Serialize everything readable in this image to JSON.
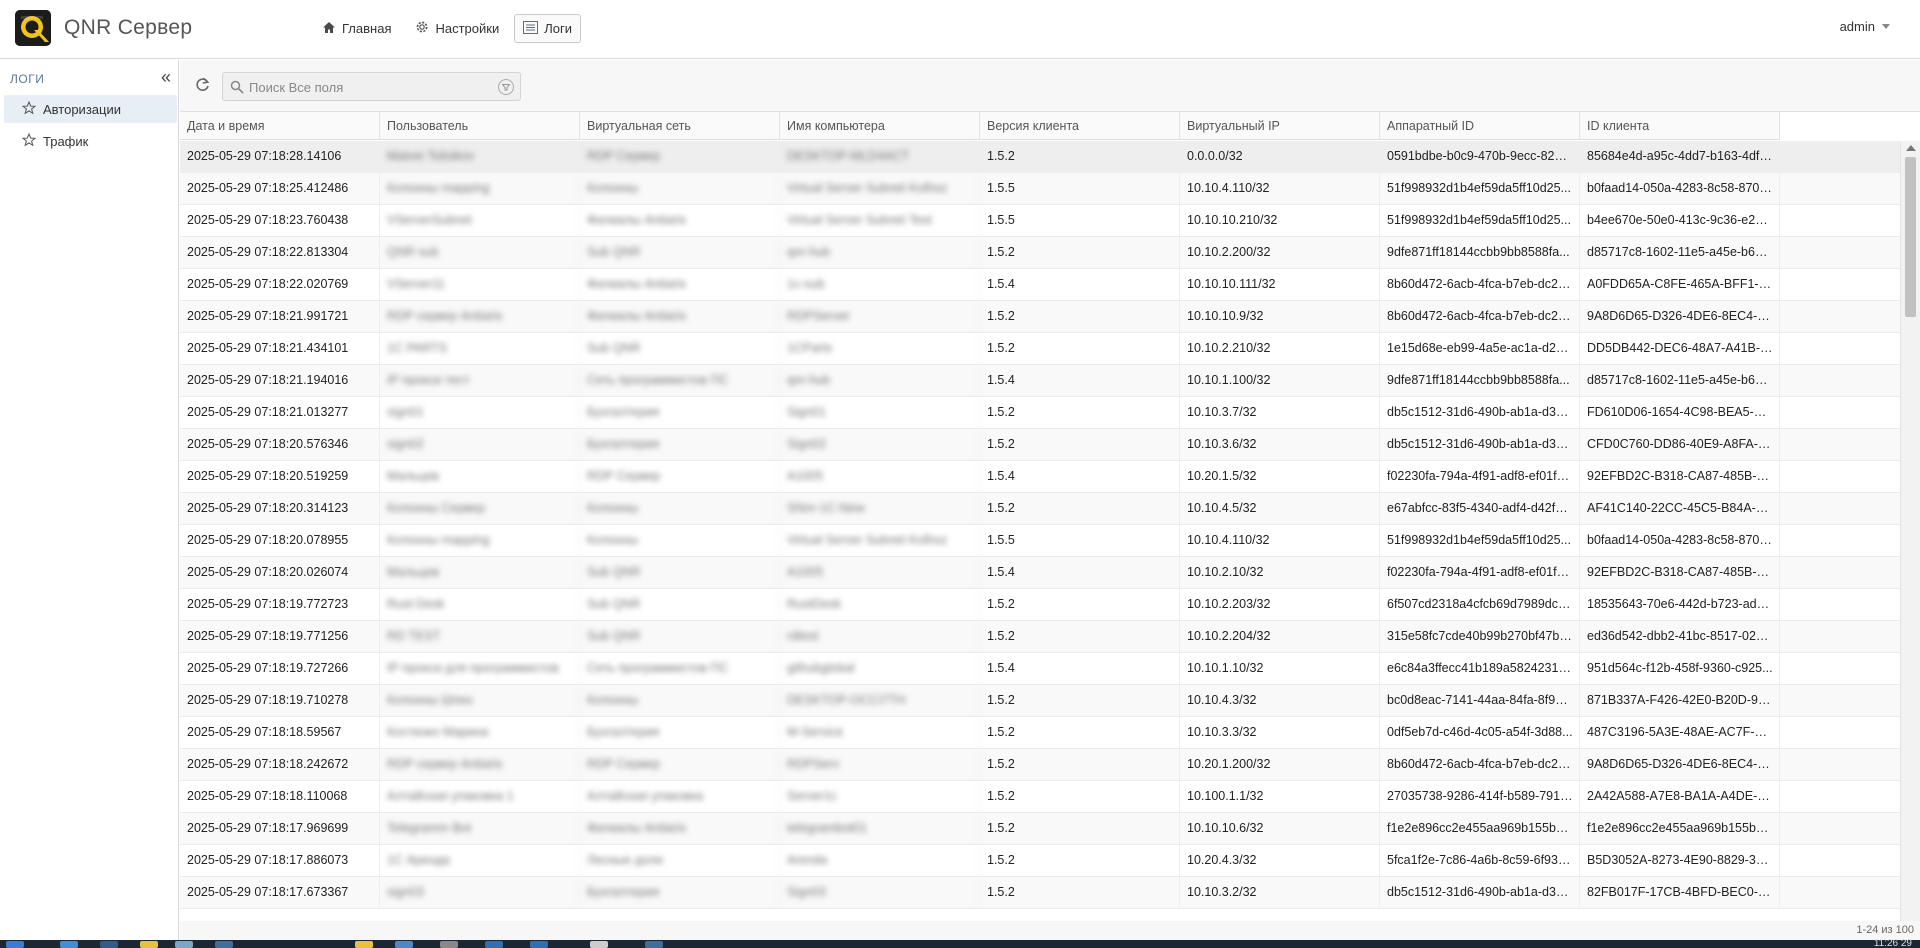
{
  "header": {
    "app_title": "QNR Сервер",
    "nav": [
      {
        "label": "Главная",
        "icon": "home-icon"
      },
      {
        "label": "Настройки",
        "icon": "gear-icon"
      },
      {
        "label": "Логи",
        "icon": "list-icon"
      }
    ],
    "active_nav": "Логи",
    "user": "admin"
  },
  "sidebar": {
    "title": "Логи",
    "items": [
      {
        "label": "Авторизации",
        "icon": "star-icon"
      },
      {
        "label": "Трафик",
        "icon": "star-icon"
      }
    ],
    "active_item": "Авторизации"
  },
  "toolbar": {
    "search_placeholder": "Поиск Все поля"
  },
  "table": {
    "columns": [
      "Дата и время",
      "Пользователь",
      "Виртуальная сеть",
      "Имя компьютера",
      "Версия клиента",
      "Виртуальный IP",
      "Аппаратный ID",
      "ID клиента"
    ],
    "rows": [
      [
        "2025-05-29 07:18:28.14106",
        "Matvei Tsitsikov",
        "RDP Сервер",
        "DESKTOP-MLD4ACT",
        "1.5.2",
        "0.0.0.0/32",
        "0591bdbe-b0c9-470b-9ecc-822b...",
        "85684e4d-a95c-4dd7-b163-4df0..."
      ],
      [
        "2025-05-29 07:18:25.412486",
        "Колонны mapping",
        "Колонны",
        "Virtual Server Subnet Kolhoz",
        "1.5.5",
        "10.10.4.110/32",
        "51f998932d1b4ef59da5ff10d25...",
        "b0faad14-050a-4283-8c58-870c..."
      ],
      [
        "2025-05-29 07:18:23.760438",
        "VServerSubnet",
        "Филиалы Antiaris",
        "Virtual Server Subnet Test",
        "1.5.5",
        "10.10.10.210/32",
        "51f998932d1b4ef59da5ff10d25...",
        "b4ee670e-50e0-413c-9c36-e26f..."
      ],
      [
        "2025-05-29 07:18:22.813304",
        "QNR sub",
        "Sub QNR",
        "qnr-hub",
        "1.5.2",
        "10.10.2.200/32",
        "9dfe871ff18144ccbb9bb8588fa...",
        "d85717c8-1602-11e5-a45e-b6a7..."
      ],
      [
        "2025-05-29 07:18:22.020769",
        "VServer11",
        "Филиалы Antiaris",
        "1c-sub",
        "1.5.4",
        "10.10.10.111/32",
        "8b60d472-6acb-4fca-b7eb-dc23...",
        "A0FDD65A-C8FE-465A-BFF1-F73..."
      ],
      [
        "2025-05-29 07:18:21.991721",
        "RDP сервер Antiaris",
        "Филиалы Antiaris",
        "RDPServer",
        "1.5.2",
        "10.10.10.9/32",
        "8b60d472-6acb-4fca-b7eb-dc23...",
        "9A8D6D65-D326-4DE6-8EC4-6D..."
      ],
      [
        "2025-05-29 07:18:21.434101",
        "1C PARTS",
        "Sub QNR",
        "1CParts",
        "1.5.2",
        "10.10.2.210/32",
        "1e15d68e-eb99-4a5e-ac1a-d27...",
        "DD5DB442-DEC6-48A7-A41B-16..."
      ],
      [
        "2025-05-29 07:18:21.194016",
        "IP прокси тест",
        "Сеть программистов ПС",
        "qnr-hub",
        "1.5.4",
        "10.10.1.100/32",
        "9dfe871ff18144ccbb9bb8588fa...",
        "d85717c8-1602-11e5-a45e-b6a7..."
      ],
      [
        "2025-05-29 07:18:21.013277",
        "sign01",
        "Бухгалтерия",
        "Sign01",
        "1.5.2",
        "10.10.3.7/32",
        "db5c1512-31d6-490b-ab1a-d3e...",
        "FD610D06-1654-4C98-BEA5-132..."
      ],
      [
        "2025-05-29 07:18:20.576346",
        "sign02",
        "Бухгалтерия",
        "Sign02",
        "1.5.2",
        "10.10.3.6/32",
        "db5c1512-31d6-490b-ab1a-d3e...",
        "CFD0C760-DD86-40E9-A8FA-0B..."
      ],
      [
        "2025-05-29 07:18:20.519259",
        "Мальцев",
        "RDP Сервер",
        "A1005",
        "1.5.4",
        "10.20.1.5/32",
        "f02230fa-794a-4f91-adf8-ef01f1...",
        "92EFBD2C-B318-CA87-485B-D5..."
      ],
      [
        "2025-05-29 07:18:20.314123",
        "Колонны Сервер",
        "Колонны",
        "SNnr-1C-New",
        "1.5.2",
        "10.10.4.5/32",
        "e67abfcc-83f5-4340-adf4-d42faf...",
        "AF41C140-22CC-45C5-B84A-FD9..."
      ],
      [
        "2025-05-29 07:18:20.078955",
        "Колонны mapping",
        "Колонны",
        "Virtual Server Subnet Kolhoz",
        "1.5.5",
        "10.10.4.110/32",
        "51f998932d1b4ef59da5ff10d25...",
        "b0faad14-050a-4283-8c58-870c..."
      ],
      [
        "2025-05-29 07:18:20.026074",
        "Мальцев",
        "Sub QNR",
        "A1005",
        "1.5.4",
        "10.10.2.10/32",
        "f02230fa-794a-4f91-adf8-ef01f1...",
        "92EFBD2C-B318-CA87-485B-D5..."
      ],
      [
        "2025-05-29 07:18:19.772723",
        "Rust Desk",
        "Sub QNR",
        "RustDesk",
        "1.5.2",
        "10.10.2.203/32",
        "6f507cd2318a4cfcb69d7989dc5...",
        "18535643-70e6-442d-b723-ada..."
      ],
      [
        "2025-05-29 07:18:19.771256",
        "RD TEST",
        "Sub QNR",
        "rdtest",
        "1.5.2",
        "10.10.2.204/32",
        "315e58fc7cde40b99b270bf47bf...",
        "ed36d542-dbb2-41bc-8517-028..."
      ],
      [
        "2025-05-29 07:18:19.727266",
        "IP прокси для программистов",
        "Сеть программистов ПС",
        "githubglobal",
        "1.5.4",
        "10.10.1.10/32",
        "e6c84a3ffecc41b189a58242314...",
        "951d564c-f12b-458f-9360-c925..."
      ],
      [
        "2025-05-29 07:18:19.710278",
        "Колонны Шпиз",
        "Колонны",
        "DESKTOP-OCCI7TH",
        "1.5.2",
        "10.10.4.3/32",
        "bc0d8eac-7141-44aa-84fa-8f9ec...",
        "871B337A-F426-42E0-B20D-91F..."
      ],
      [
        "2025-05-29 07:18:18.59567",
        "Костенко Марина",
        "Бухгалтерия",
        "M-Service",
        "1.5.2",
        "10.10.3.3/32",
        "0df5eb7d-c46d-4c05-a54f-3d88...",
        "487C3196-5A3E-48AE-AC7F-CA9..."
      ],
      [
        "2025-05-29 07:18:18.242672",
        "RDP сервер Antiaris",
        "RDP Сервер",
        "RDPServ",
        "1.5.2",
        "10.20.1.200/32",
        "8b60d472-6acb-4fca-b7eb-dc23...",
        "9A8D6D65-D326-4DE6-8EC4-6D..."
      ],
      [
        "2025-05-29 07:18:18.110068",
        "Алтайская упаковка 1",
        "Алтайская упаковка",
        "Server1c",
        "1.5.2",
        "10.100.1.1/32",
        "27035738-9286-414f-b589-7917...",
        "2A42A588-A7E8-BA1A-A4DE-D8..."
      ],
      [
        "2025-05-29 07:18:17.969699",
        "Telegramm Bot",
        "Филиалы Antiaris",
        "telegrambot01",
        "1.5.2",
        "10.10.10.6/32",
        "f1e2e896cc2e455aa969b155b4...",
        "f1e2e896cc2e455aa969b155b4..."
      ],
      [
        "2025-05-29 07:18:17.886073",
        "1С Аренда",
        "Лесные доли",
        "Arenda",
        "1.5.2",
        "10.20.4.3/32",
        "5fca1f2e-7c86-4a6b-8c59-6f93a...",
        "B5D3052A-8273-4E90-8829-335..."
      ],
      [
        "2025-05-29 07:18:17.673367",
        "sign03",
        "Бухгалтерия",
        "Sign03",
        "1.5.2",
        "10.10.3.2/32",
        "db5c1512-31d6-490b-ab1a-d3e...",
        "82FB017F-17CB-4BFD-BEC0-28F..."
      ]
    ]
  },
  "footer": {
    "paging": "1-24 из 100"
  },
  "taskbar": {
    "clock": "11:26 29"
  },
  "colors": {
    "selected_row": "#eeeeee",
    "active_sidebar": "#e8eef5",
    "header_border": "#d8d8d8"
  }
}
